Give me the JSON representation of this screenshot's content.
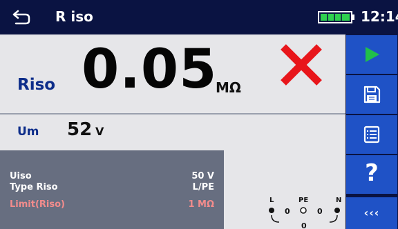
{
  "header": {
    "title": "R iso",
    "time": "12:14",
    "back_icon": "back-arrow-icon",
    "battery_icon": "battery-icon"
  },
  "measurement": {
    "riso_label": "Riso",
    "riso_value": "0.05",
    "riso_unit": "MΩ",
    "status_icon": "fail-x-icon",
    "status_color": "#e8161b",
    "um_label": "Um",
    "um_value": "52",
    "um_unit": "V"
  },
  "parameters": [
    {
      "label": "Uiso",
      "value": "50 V"
    },
    {
      "label": "Type Riso",
      "value": "L/PE"
    },
    {
      "label": "Limit(Riso)",
      "value": "1 MΩ"
    }
  ],
  "terminals": {
    "labels": [
      "L",
      "PE",
      "N"
    ],
    "values": [
      "0",
      "0",
      "0"
    ]
  },
  "sidebar": {
    "buttons": [
      "play-icon",
      "save-icon",
      "list-icon",
      "help-icon",
      "more-icon"
    ],
    "help_label": "?",
    "more_label": "‹‹‹"
  },
  "colors": {
    "header_bg": "#0a1342",
    "sidebar_button": "#1f52c6",
    "accent_green": "#21c04a",
    "label_blue": "#0d2d8a",
    "limit_red": "#f28c8c"
  }
}
